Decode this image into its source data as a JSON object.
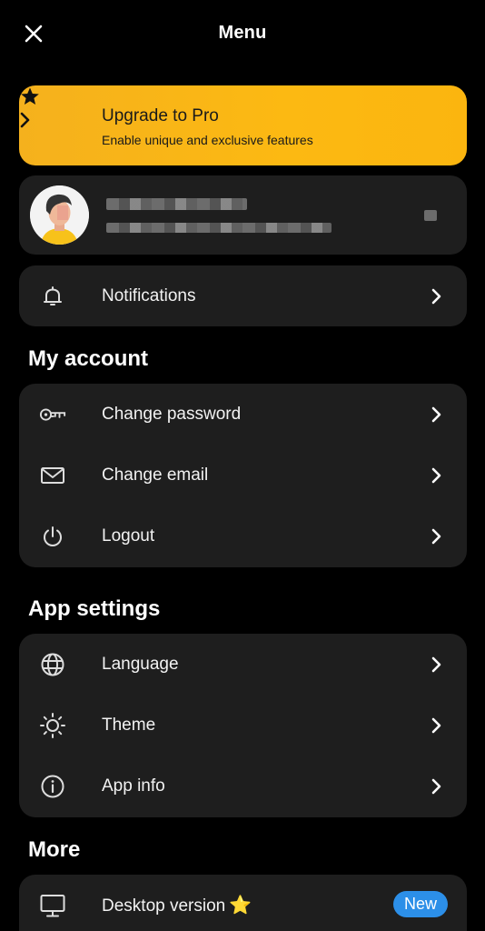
{
  "header": {
    "title": "Menu",
    "close_icon": "close-icon"
  },
  "upgrade": {
    "title": "Upgrade to Pro",
    "subtitle": "Enable unique and exclusive features",
    "icon": "star-icon",
    "color": "#fcb912"
  },
  "notifications": {
    "label": "Notifications",
    "icon": "bell-icon"
  },
  "account": {
    "title": "My account",
    "items": [
      {
        "label": "Change password",
        "icon": "key-icon"
      },
      {
        "label": "Change email",
        "icon": "mail-icon"
      },
      {
        "label": "Logout",
        "icon": "power-icon"
      }
    ]
  },
  "settings": {
    "title": "App settings",
    "items": [
      {
        "label": "Language",
        "icon": "globe-icon"
      },
      {
        "label": "Theme",
        "icon": "sun-icon"
      },
      {
        "label": "App info",
        "icon": "info-icon"
      }
    ]
  },
  "more": {
    "title": "More",
    "items": [
      {
        "label": "Desktop version",
        "icon": "monitor-icon",
        "emoji": "⭐",
        "badge": "New",
        "badge_color": "#2c8fe8"
      }
    ]
  }
}
